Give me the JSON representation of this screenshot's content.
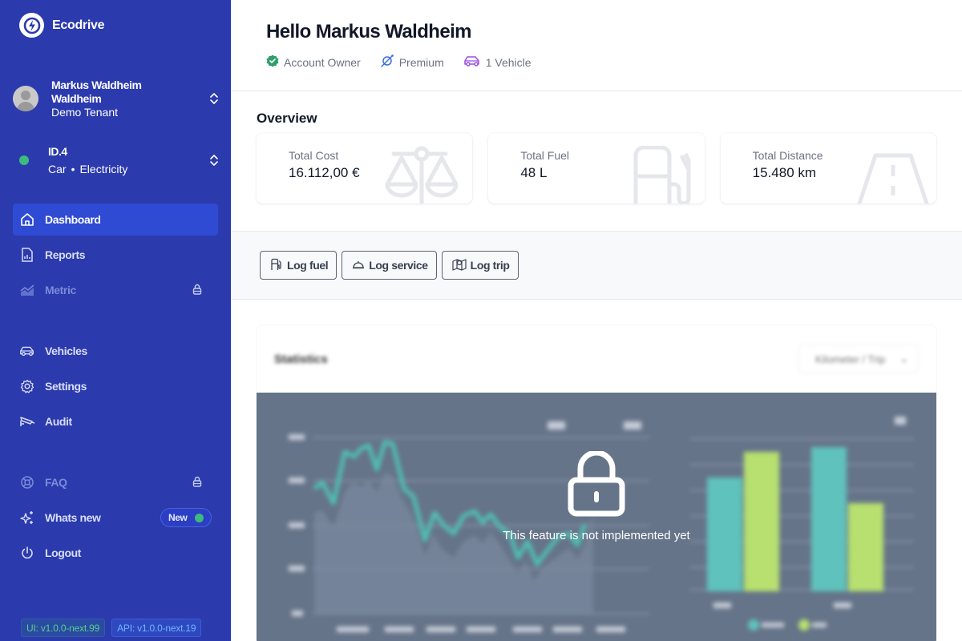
{
  "app": {
    "name": "Ecodrive",
    "brand_color": "#2b3aad",
    "active_color": "#2f4bd3"
  },
  "user": {
    "name": "Markus Waldheim Waldheim",
    "tenant": "Demo Tenant"
  },
  "vehicle": {
    "name": "ID.4",
    "type": "Car",
    "separator": "•",
    "fuel": "Electricity",
    "status_color": "#3dbb7d"
  },
  "sidebar": {
    "primary": [
      {
        "label": "Dashboard",
        "icon": "home-icon",
        "active": true,
        "locked": false
      },
      {
        "label": "Reports",
        "icon": "report-file-icon",
        "active": false,
        "locked": false
      },
      {
        "label": "Metric",
        "icon": "chart-area-icon",
        "active": false,
        "locked": true
      }
    ],
    "secondary": [
      {
        "label": "Vehicles",
        "icon": "car-icon"
      },
      {
        "label": "Settings",
        "icon": "gear-icon"
      },
      {
        "label": "Audit",
        "icon": "security-camera-icon"
      }
    ],
    "tertiary": [
      {
        "label": "FAQ",
        "icon": "lifebuoy-icon",
        "locked": true
      },
      {
        "label": "Whats new",
        "icon": "sparkles-icon",
        "badge": "New"
      },
      {
        "label": "Logout",
        "icon": "power-icon"
      }
    ],
    "versions": {
      "ui": "UI: v1.0.0-next.99",
      "api": "API: v1.0.0-next.19"
    }
  },
  "header": {
    "greeting": "Hello Markus Waldheim",
    "badges": [
      {
        "label": "Account Owner",
        "icon": "verified-badge-icon",
        "color": "#2e9e6a"
      },
      {
        "label": "Premium",
        "icon": "planet-icon",
        "color": "#3b6fe0"
      },
      {
        "label": "1 Vehicle",
        "icon": "car-icon",
        "color": "#9b4fe3"
      }
    ]
  },
  "overview": {
    "title": "Overview",
    "cards": [
      {
        "label": "Total Cost",
        "value": "16.112,00 €",
        "icon": "scale-icon"
      },
      {
        "label": "Total Fuel",
        "value": "48 L",
        "icon": "fuel-pump-icon"
      },
      {
        "label": "Total Distance",
        "value": "15.480 km",
        "icon": "road-icon"
      }
    ]
  },
  "actions": [
    {
      "label": "Log fuel",
      "icon": "fuel-pump-icon"
    },
    {
      "label": "Log service",
      "icon": "service-bell-icon"
    },
    {
      "label": "Log trip",
      "icon": "map-pin-icon"
    }
  ],
  "statistics": {
    "title": "Statistics",
    "select_value": "Kilometer / Trip",
    "locked_message": "This feature is not implemented yet",
    "line_color": "#4fc3b6",
    "bar_colors": [
      "#5fc2bc",
      "#b7e070"
    ]
  }
}
